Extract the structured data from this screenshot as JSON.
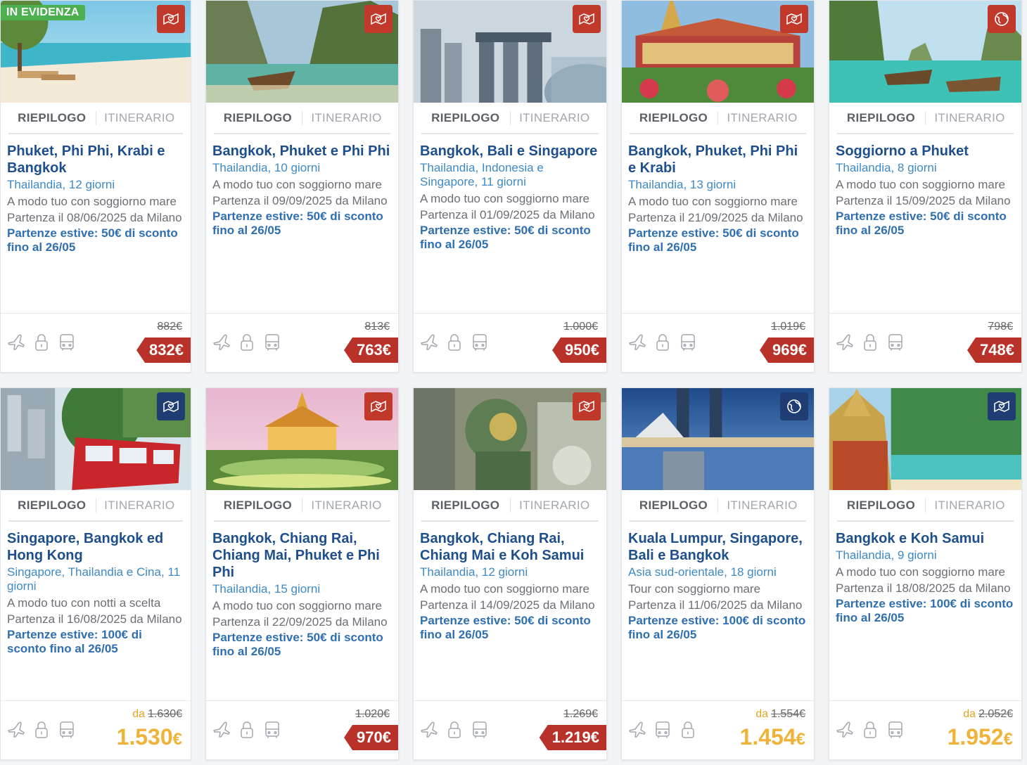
{
  "tabs": {
    "summary": "RIEPILOGO",
    "itinerary": "ITINERARIO"
  },
  "featured_label": "IN EVIDENZA",
  "colors": {
    "title": "#1e4f8c",
    "subtitle": "#3f8ac4",
    "promo": "#2f6fb0",
    "price_tag": "#b8322a",
    "price_from": "#f0b33a",
    "badge_red": "#c0392b",
    "badge_navy": "#1f3d73",
    "featured": "#4caf50"
  },
  "cards": [
    {
      "title": "Phuket, Phi Phi, Krabi e Bangkok",
      "subtitle": "Thailandia, 12 giorni",
      "desc": "A modo tuo con soggiorno mare",
      "departure": "Partenza il 08/06/2025 da Milano",
      "promo": "Partenze estive: 50€ di sconto fino al 26/05",
      "old_price": "882€",
      "price": "832€",
      "price_style": "tag",
      "from_label": "",
      "type_icon": "map-heart-icon",
      "type_color": "red",
      "features": [
        "plane-icon",
        "lock-icon",
        "bus-icon"
      ],
      "featured": true
    },
    {
      "title": "Bangkok, Phuket e Phi Phi",
      "subtitle": "Thailandia, 10 giorni",
      "desc": "A modo tuo con soggiorno mare",
      "departure": "Partenza il 09/09/2025 da Milano",
      "promo": "Partenze estive: 50€ di sconto fino al 26/05",
      "old_price": "813€",
      "price": "763€",
      "price_style": "tag",
      "from_label": "",
      "type_icon": "map-heart-icon",
      "type_color": "red",
      "features": [
        "plane-icon",
        "lock-icon",
        "bus-icon"
      ],
      "featured": false
    },
    {
      "title": "Bangkok, Bali e Singapore",
      "subtitle": "Thailandia, Indonesia e Singapore, 11 giorni",
      "desc": "A modo tuo con soggiorno mare",
      "departure": "Partenza il 01/09/2025 da Milano",
      "promo": "Partenze estive: 50€ di sconto fino al 26/05",
      "old_price": "1.000€",
      "price": "950€",
      "price_style": "tag",
      "from_label": "",
      "type_icon": "map-heart-icon",
      "type_color": "red",
      "features": [
        "plane-icon",
        "lock-icon",
        "bus-icon"
      ],
      "featured": false
    },
    {
      "title": "Bangkok, Phuket, Phi Phi e Krabi",
      "subtitle": "Thailandia, 13 giorni",
      "desc": "A modo tuo con soggiorno mare",
      "departure": "Partenza il 21/09/2025 da Milano",
      "promo": "Partenze estive: 50€ di sconto fino al 26/05",
      "old_price": "1.019€",
      "price": "969€",
      "price_style": "tag",
      "from_label": "",
      "type_icon": "map-heart-icon",
      "type_color": "red",
      "features": [
        "plane-icon",
        "lock-icon",
        "bus-icon"
      ],
      "featured": false
    },
    {
      "title": "Soggiorno a Phuket",
      "subtitle": "Thailandia, 8 giorni",
      "desc": "A modo tuo con soggiorno mare",
      "departure": "Partenza il 15/09/2025 da Milano",
      "promo": "Partenze estive: 50€ di sconto fino al 26/05",
      "old_price": "798€",
      "price": "748€",
      "price_style": "tag",
      "from_label": "",
      "type_icon": "globe-icon",
      "type_color": "red",
      "features": [
        "plane-icon",
        "lock-icon",
        "bus-icon"
      ],
      "featured": false
    },
    {
      "title": "Singapore, Bangkok ed Hong Kong",
      "subtitle": "Singapore, Thailandia e Cina, 11 giorni",
      "desc": "A modo tuo con notti a scelta",
      "departure": "Partenza il 16/08/2025 da Milano",
      "promo": "Partenze estive: 100€ di sconto fino al 26/05",
      "old_price": "1.630€",
      "price": "1.530",
      "price_currency": "€",
      "price_style": "from",
      "from_label": "da",
      "type_icon": "map-heart-icon",
      "type_color": "navy",
      "features": [
        "plane-icon",
        "lock-icon",
        "bus-icon"
      ],
      "featured": false
    },
    {
      "title": "Bangkok, Chiang Rai, Chiang Mai, Phuket e Phi Phi",
      "subtitle": "Thailandia, 15 giorni",
      "desc": "A modo tuo con soggiorno mare",
      "departure": "Partenza il 22/09/2025 da Milano",
      "promo": "Partenze estive: 50€ di sconto fino al 26/05",
      "old_price": "1.020€",
      "price": "970€",
      "price_style": "tag",
      "from_label": "",
      "type_icon": "map-heart-icon",
      "type_color": "red",
      "features": [
        "plane-icon",
        "lock-icon",
        "bus-icon"
      ],
      "featured": false
    },
    {
      "title": "Bangkok, Chiang Rai, Chiang Mai e Koh Samui",
      "subtitle": "Thailandia, 12 giorni",
      "desc": "A modo tuo con soggiorno mare",
      "departure": "Partenza il 14/09/2025 da Milano",
      "promo": "Partenze estive: 50€ di sconto fino al 26/05",
      "old_price": "1.269€",
      "price": "1.219€",
      "price_style": "tag",
      "from_label": "",
      "type_icon": "map-heart-icon",
      "type_color": "red",
      "features": [
        "plane-icon",
        "lock-icon",
        "bus-icon"
      ],
      "featured": false
    },
    {
      "title": "Kuala Lumpur, Singapore, Bali e Bangkok",
      "subtitle": "Asia sud-orientale, 18 giorni",
      "desc": "Tour con soggiorno mare",
      "departure": "Partenza il 11/06/2025 da Milano",
      "promo": "Partenze estive: 100€ di sconto fino al 26/05",
      "old_price": "1.554€",
      "price": "1.454",
      "price_currency": "€",
      "price_style": "from",
      "from_label": "da",
      "type_icon": "globe-icon",
      "type_color": "navy",
      "features": [
        "plane-icon",
        "bus-icon",
        "lock-icon"
      ],
      "featured": false
    },
    {
      "title": "Bangkok e Koh Samui",
      "subtitle": "Thailandia, 9 giorni",
      "desc": "A modo tuo con soggiorno mare",
      "departure": "Partenza il 18/08/2025 da Milano",
      "promo": "Partenze estive: 100€ di sconto fino al 26/05",
      "old_price": "2.052€",
      "price": "1.952",
      "price_currency": "€",
      "price_style": "from",
      "from_label": "da",
      "type_icon": "map-heart-icon",
      "type_color": "navy",
      "features": [
        "plane-icon",
        "lock-icon",
        "bus-icon"
      ],
      "featured": false
    }
  ]
}
